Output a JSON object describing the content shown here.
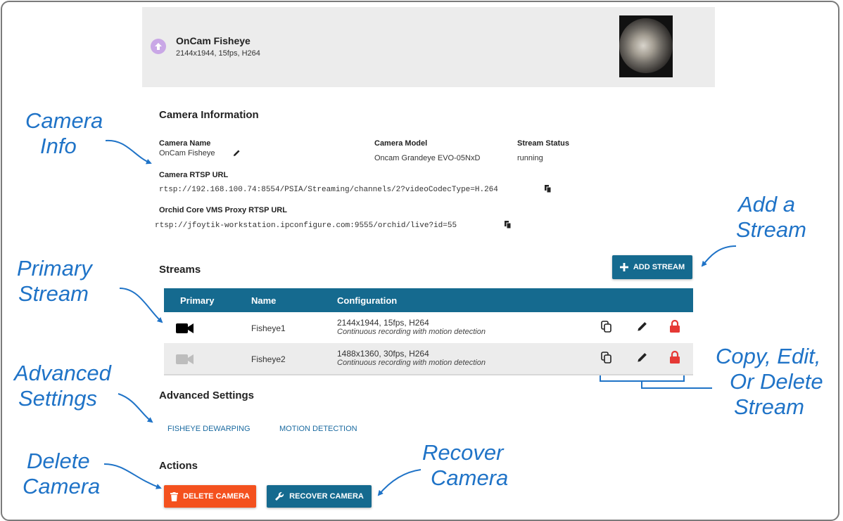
{
  "header": {
    "camera_title": "OnCam Fisheye",
    "camera_sub": "2144x1944, 15fps, H264"
  },
  "camera_info": {
    "section_title": "Camera Information",
    "name_label": "Camera Name",
    "name_value": "OnCam Fisheye",
    "model_label": "Camera Model",
    "model_value": "Oncam Grandeye EVO-05NxD",
    "status_label": "Stream Status",
    "status_value": "running",
    "rtsp_label": "Camera RTSP URL",
    "rtsp_value": "rtsp://192.168.100.74:8554/PSIA/Streaming/channels/2?videoCodecType=H.264",
    "proxy_label": "Orchid Core VMS Proxy RTSP URL",
    "proxy_value": "rtsp://jfoytik-workstation.ipconfigure.com:9555/orchid/live?id=55"
  },
  "streams": {
    "section_title": "Streams",
    "add_button": "ADD STREAM",
    "columns": [
      "Primary",
      "Name",
      "Configuration"
    ],
    "rows": [
      {
        "name": "Fisheye1",
        "config": "2144x1944, 15fps, H264",
        "mode": "Continuous recording with motion detection",
        "primary": true
      },
      {
        "name": "Fisheye2",
        "config": "1488x1360, 30fps, H264",
        "mode": "Continuous recording with motion detection",
        "primary": false
      }
    ]
  },
  "advanced": {
    "section_title": "Advanced Settings",
    "links": [
      "FISHEYE DEWARPING",
      "MOTION DETECTION"
    ]
  },
  "actions": {
    "section_title": "Actions",
    "delete_button": "DELETE CAMERA",
    "recover_button": "RECOVER CAMERA"
  },
  "annotations": {
    "camera_info": [
      "Camera",
      "Info"
    ],
    "add_stream": [
      "Add a",
      "Stream"
    ],
    "primary_stream": [
      "Primary",
      "Stream"
    ],
    "copy_edit_delete": [
      "Copy, Edit,",
      "Or Delete",
      "Stream"
    ],
    "advanced_settings": [
      "Advanced",
      "Settings"
    ],
    "delete_camera": [
      "Delete",
      "Camera"
    ],
    "recover_camera": [
      "Recover",
      "Camera"
    ]
  },
  "colors": {
    "accent": "#156a8f",
    "annotation": "#1f73c7",
    "delete": "#f4511e",
    "lock": "#e53935",
    "header_bg": "#ececec",
    "row_alt": "#ececec"
  }
}
